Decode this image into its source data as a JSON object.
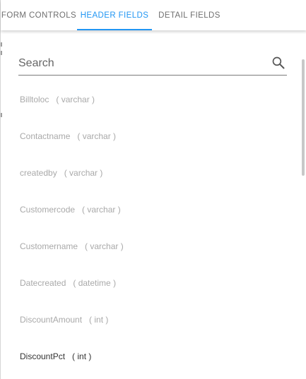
{
  "tabs": [
    {
      "label": "FORM CONTROLS"
    },
    {
      "label": "HEADER FIELDS"
    },
    {
      "label": "DETAIL FIELDS"
    }
  ],
  "active_tab": "HEADER FIELDS",
  "search": {
    "placeholder": "Search",
    "value": ""
  },
  "fields": [
    {
      "name": "Billtoloc",
      "type": "( varchar )"
    },
    {
      "name": "Contactname",
      "type": "( varchar )"
    },
    {
      "name": "createdby",
      "type": "( varchar )"
    },
    {
      "name": "Customercode",
      "type": "( varchar )"
    },
    {
      "name": "Customername",
      "type": "( varchar )"
    },
    {
      "name": "Datecreated",
      "type": "( datetime )"
    },
    {
      "name": "DiscountAmount",
      "type": "( int )"
    },
    {
      "name": "DiscountPct",
      "type": "( int )"
    }
  ],
  "colors": {
    "accent": "#2196f3",
    "tab_text": "#6f6f6f",
    "field_muted": "#a9a9a9",
    "field_dark": "#333333"
  }
}
